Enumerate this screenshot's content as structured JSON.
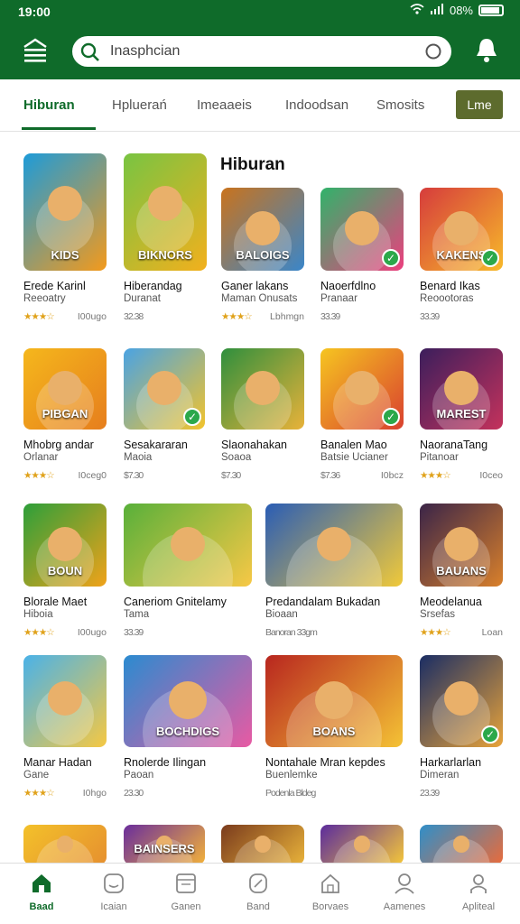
{
  "status": {
    "time": "19:00",
    "battery": "08%"
  },
  "search": {
    "placeholder": "Inasphcian"
  },
  "tabs": [
    {
      "label": "Hiburan",
      "active": true
    },
    {
      "label": "Hpluerań"
    },
    {
      "label": "Imeaaeis"
    },
    {
      "label": "Indoodsan"
    },
    {
      "label": "Smosits"
    }
  ],
  "tab_button": "Lme",
  "section_title": "Hiburan",
  "cards": [
    {
      "cap": "KIDS",
      "name": "Erede Karinl",
      "sub": "Reeoatry",
      "rating": "★★★☆",
      "price": "I00ugo",
      "c1": "#1d9bd9",
      "c2": "#f39a1c",
      "badge": false
    },
    {
      "cap": "BIKNORS",
      "name": "Hiberandag",
      "sub": "Duranat",
      "rating": "",
      "price": "32.38",
      "c1": "#78c442",
      "c2": "#f2b01d",
      "badge": false
    },
    {
      "cap": "BALOIGS",
      "name": "Ganer lakans",
      "sub": "Maman Onusats",
      "rating": "★★★☆",
      "price": "Lbhmgn",
      "c1": "#c9731d",
      "c2": "#3a86c9",
      "badge": false
    },
    {
      "cap": "",
      "name": "Naoerfdlno",
      "sub": "Pranaar",
      "rating": "",
      "price": "33.39",
      "c1": "#30b36a",
      "c2": "#ec3f7e",
      "badge": true
    },
    {
      "cap": "KAKENS",
      "name": "Benard Ikas",
      "sub": "Reoootoras",
      "rating": "",
      "price": "33.39",
      "c1": "#d63c3c",
      "c2": "#f7b92a",
      "badge": true
    },
    {
      "cap": "PIBGAN",
      "name": "Mhobrg andar",
      "sub": "Orlanar",
      "rating": "★★★☆",
      "price": "I0ceg0",
      "c1": "#f5b71c",
      "c2": "#e67e1d",
      "badge": false
    },
    {
      "cap": "",
      "name": "Sesakararan",
      "sub": "Maoia",
      "rating": "",
      "price": "$7.30",
      "c1": "#4aa3e3",
      "c2": "#f2c32c",
      "badge": true
    },
    {
      "cap": "",
      "name": "Slaonahakan",
      "sub": "Soaoa",
      "rating": "",
      "price": "$7.30",
      "c1": "#2f8f3d",
      "c2": "#e8b23a",
      "badge": false
    },
    {
      "cap": "",
      "name": "Banalen Mao",
      "sub": "Batsie Ucianer",
      "rating": "",
      "price": "$7.36",
      "extra": "I0bcz",
      "c1": "#f6c520",
      "c2": "#d9402f",
      "badge": true
    },
    {
      "cap": "MAREST",
      "name": "NaoranaTang",
      "sub": "Pitanoar",
      "rating": "★★★☆",
      "price": "I0ceo",
      "c1": "#3b1e5c",
      "c2": "#c4325c",
      "badge": false
    },
    {
      "cap": "BOUN",
      "name": "Blorale Maet",
      "sub": "Hiboia",
      "rating": "★★★☆",
      "price": "I00ugo",
      "c1": "#2d9f3a",
      "c2": "#f0a21a",
      "badge": false
    },
    {
      "cap": "",
      "name": "Caneriom Gnitelamy",
      "sub": "Tama",
      "rating": "",
      "price": "33.39",
      "c1": "#58b03a",
      "c2": "#f7c846",
      "badge": false,
      "wide": true
    },
    {
      "cap": "",
      "name": "Predandalam Bukadan",
      "sub": "Bioaan",
      "rating": "",
      "price": "Banoran 33gm",
      "c1": "#2a5db5",
      "c2": "#f0c93a",
      "badge": false,
      "wide": true
    },
    {
      "cap": "BAUANS",
      "name": "Meodelanua",
      "sub": "Srsefas",
      "rating": "★★★☆",
      "price": "Loan",
      "c1": "#3a2448",
      "c2": "#d9802b",
      "badge": false
    },
    {
      "cap": "",
      "name": "Manar Hadan",
      "sub": "Gane",
      "rating": "★★★☆",
      "price": "I0hgo",
      "c1": "#4ab2e8",
      "c2": "#f5c843",
      "badge": false
    },
    {
      "cap": "BOCHDIGS",
      "name": "Rnolerde Ilingan",
      "sub": "Paoan",
      "rating": "",
      "price": "23.30",
      "c1": "#2b8bd0",
      "c2": "#e85aa3",
      "badge": false,
      "wide": true
    },
    {
      "cap": "BOANS",
      "name": "Nontahale Mran kepdes",
      "sub": "Buenlemke",
      "rating": "",
      "price": "Podenla Bldeg",
      "c1": "#b8261f",
      "c2": "#f4c235",
      "badge": false,
      "wide": true
    },
    {
      "cap": "",
      "name": "Harkarlarlan",
      "sub": "Dimeran",
      "rating": "",
      "price": "23.39",
      "c1": "#1a2d64",
      "c2": "#e8a33a",
      "badge": true
    },
    {
      "cap": "",
      "name": "",
      "sub": "",
      "rating": "",
      "price": "",
      "c1": "#f3c12a",
      "c2": "#e6902f",
      "badge": false
    },
    {
      "cap": "BAINSERS",
      "name": "",
      "sub": "",
      "rating": "",
      "price": "",
      "c1": "#6a2d9c",
      "c2": "#f2b13a",
      "badge": false
    },
    {
      "cap": "",
      "name": "",
      "sub": "",
      "rating": "",
      "price": "",
      "c1": "#7a3b1d",
      "c2": "#e8b23a",
      "badge": false
    },
    {
      "cap": "",
      "name": "",
      "sub": "",
      "rating": "",
      "price": "",
      "c1": "#5b2b9d",
      "c2": "#f4c63a",
      "badge": false
    },
    {
      "cap": "",
      "name": "",
      "sub": "",
      "rating": "",
      "price": "",
      "c1": "#2f8fc9",
      "c2": "#e96b3b",
      "badge": false
    }
  ],
  "bottom_nav": [
    {
      "label": "Baad",
      "icon": "home-icon",
      "active": true
    },
    {
      "label": "Icaian",
      "icon": "smile-icon"
    },
    {
      "label": "Ganen",
      "icon": "window-icon"
    },
    {
      "label": "Band",
      "icon": "leaf-icon"
    },
    {
      "label": "Borvaes",
      "icon": "house-outline-icon"
    },
    {
      "label": "Aamenes",
      "icon": "person-icon"
    },
    {
      "label": "Apliteal",
      "icon": "user-icon"
    }
  ]
}
